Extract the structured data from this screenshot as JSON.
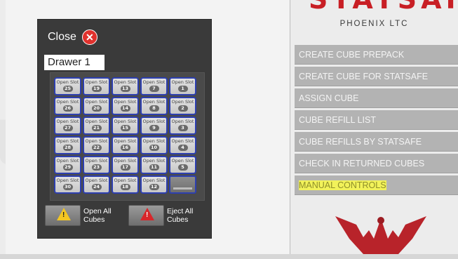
{
  "watermark": "tatsafe",
  "dialog": {
    "close_label": "Close",
    "drawer_title": "Drawer 1",
    "slot_label": "Open Slot",
    "slots": [
      [
        "25",
        "19",
        "13",
        "7",
        "1"
      ],
      [
        "26",
        "20",
        "14",
        "8",
        "2"
      ],
      [
        "27",
        "21",
        "15",
        "9",
        "3"
      ],
      [
        "28",
        "22",
        "16",
        "10",
        "4"
      ],
      [
        "29",
        "23",
        "17",
        "11",
        "5"
      ],
      [
        "30",
        "24",
        "18",
        "12",
        ""
      ]
    ],
    "open_all_label": "Open All Cubes",
    "eject_all_label": "Eject All Cubes"
  },
  "brand": {
    "name": "STATSAFE",
    "company": "PHOENIX LTC"
  },
  "menu": {
    "items": [
      "CREATE CUBE PREPACK",
      "CREATE CUBE FOR STATSAFE",
      "ASSIGN CUBE",
      "CUBE REFILL LIST",
      "CUBE REFILLS BY STATSAFE",
      "CHECK IN RETURNED CUBES",
      "MANUAL CONTROLS"
    ],
    "highlighted_index": 6
  },
  "colors": {
    "accent_red": "#c81f25",
    "slot_border": "#2d3fb0",
    "highlight": "#f2f25a",
    "menu_bg": "#b3b3b3"
  },
  "icons": {
    "close": "close-icon",
    "open_all": "warning-drawer-icon",
    "eject_all": "eject-warning-icon",
    "logo": "phoenix-logo"
  }
}
